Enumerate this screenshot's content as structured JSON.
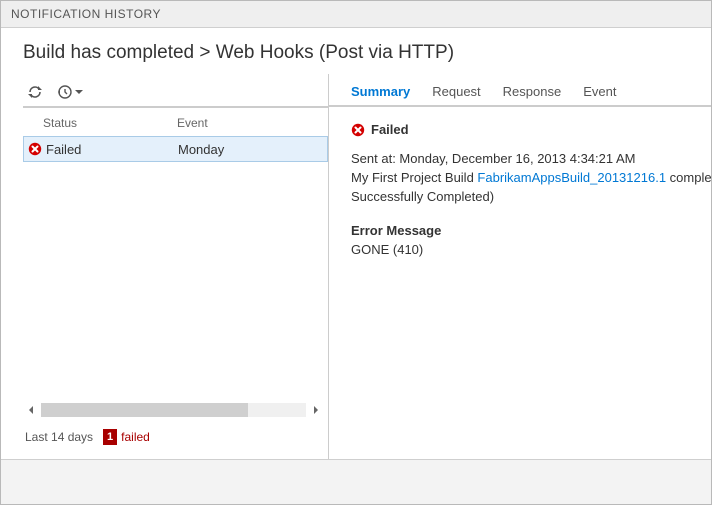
{
  "window": {
    "title": "NOTIFICATION HISTORY"
  },
  "header": {
    "breadcrumb": "Build has completed > Web Hooks (Post via HTTP)"
  },
  "grid": {
    "columns": {
      "status": "Status",
      "event": "Event"
    },
    "rows": [
      {
        "status": "Failed",
        "event": "Monday"
      }
    ]
  },
  "footer_left": {
    "range_label": "Last 14 days",
    "failed_count": "1",
    "failed_label": "failed"
  },
  "tabs": {
    "summary": "Summary",
    "request": "Request",
    "response": "Response",
    "event": "Event"
  },
  "detail": {
    "status_label": "Failed",
    "sent_prefix": "Sent at: ",
    "sent_time": "Monday, December 16, 2013 4:34:21 AM",
    "msg_prefix": "My First Project Build ",
    "build_link": "FabrikamAppsBuild_20131216.1",
    "msg_suffix_1": " completed (Status: ",
    "msg_suffix_2": "Successfully Completed)",
    "error_heading": "Error Message",
    "error_body": "GONE (410)"
  }
}
